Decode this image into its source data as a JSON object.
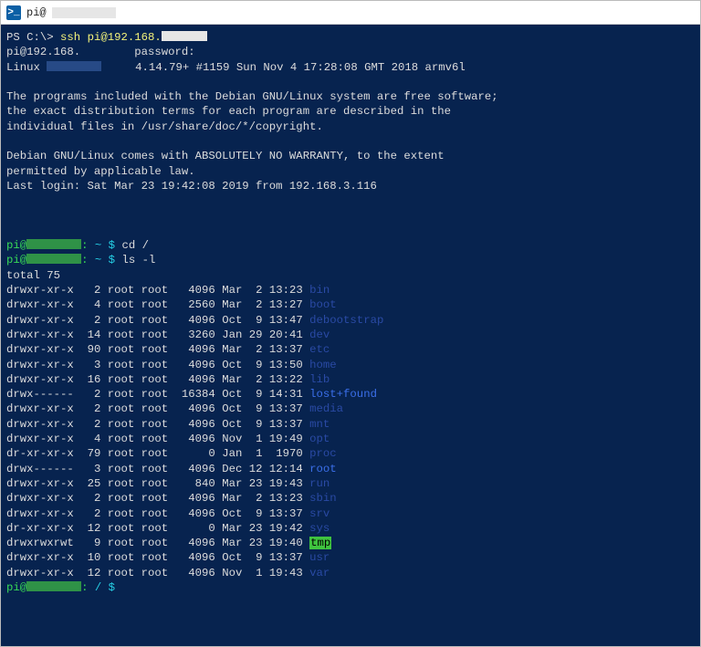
{
  "window": {
    "title": "pi@"
  },
  "prompt1": {
    "ps": "PS C:\\> ",
    "cmd": "ssh pi@192.168."
  },
  "login": {
    "line_pwd": "pi@192.168.        password:",
    "line_kernel_a": "Linux ",
    "line_kernel_b": "     4.14.79+ #1159 Sun Nov 4 17:28:08 GMT 2018 armv6l"
  },
  "motd": {
    "l1": "The programs included with the Debian GNU/Linux system are free software;",
    "l2": "the exact distribution terms for each program are described in the",
    "l3": "individual files in /usr/share/doc/*/copyright.",
    "l4": "Debian GNU/Linux comes with ABSOLUTELY NO WARRANTY, to the extent",
    "l5": "permitted by applicable law.",
    "l6": "Last login: Sat Mar 23 19:42:08 2019 from 192.168.3.116"
  },
  "p2": {
    "user": "pi@",
    "sep": ":",
    "tilde": "~ $",
    "cmd": "cd /"
  },
  "p3": {
    "user": "pi@",
    "sep": ":",
    "tilde": "~ $",
    "cmd": "ls -l"
  },
  "p4": {
    "user": "pi@",
    "sep": ":",
    "slash": "/ $"
  },
  "total": "total 75",
  "ls": [
    {
      "perm": "drwxr-xr-x",
      "n": "  2",
      "own": "root root",
      "size": "  4096",
      "date": "Mar  2 13:23",
      "name": "bin",
      "cls": "dkblue"
    },
    {
      "perm": "drwxr-xr-x",
      "n": "  4",
      "own": "root root",
      "size": "  2560",
      "date": "Mar  2 13:27",
      "name": "boot",
      "cls": "dkblue"
    },
    {
      "perm": "drwxr-xr-x",
      "n": "  2",
      "own": "root root",
      "size": "  4096",
      "date": "Oct  9 13:47",
      "name": "debootstrap",
      "cls": "dkblue"
    },
    {
      "perm": "drwxr-xr-x",
      "n": " 14",
      "own": "root root",
      "size": "  3260",
      "date": "Jan 29 20:41",
      "name": "dev",
      "cls": "dkblue"
    },
    {
      "perm": "drwxr-xr-x",
      "n": " 90",
      "own": "root root",
      "size": "  4096",
      "date": "Mar  2 13:37",
      "name": "etc",
      "cls": "dkblue"
    },
    {
      "perm": "drwxr-xr-x",
      "n": "  3",
      "own": "root root",
      "size": "  4096",
      "date": "Oct  9 13:50",
      "name": "home",
      "cls": "dkblue"
    },
    {
      "perm": "drwxr-xr-x",
      "n": " 16",
      "own": "root root",
      "size": "  4096",
      "date": "Mar  2 13:22",
      "name": "lib",
      "cls": "dkblue"
    },
    {
      "perm": "drwx------",
      "n": "  2",
      "own": "root root",
      "size": " 16384",
      "date": "Oct  9 14:31",
      "name": "lost+found",
      "cls": "blue"
    },
    {
      "perm": "drwxr-xr-x",
      "n": "  2",
      "own": "root root",
      "size": "  4096",
      "date": "Oct  9 13:37",
      "name": "media",
      "cls": "dkblue"
    },
    {
      "perm": "drwxr-xr-x",
      "n": "  2",
      "own": "root root",
      "size": "  4096",
      "date": "Oct  9 13:37",
      "name": "mnt",
      "cls": "dkblue"
    },
    {
      "perm": "drwxr-xr-x",
      "n": "  4",
      "own": "root root",
      "size": "  4096",
      "date": "Nov  1 19:49",
      "name": "opt",
      "cls": "dkblue"
    },
    {
      "perm": "dr-xr-xr-x",
      "n": " 79",
      "own": "root root",
      "size": "     0",
      "date": "Jan  1  1970",
      "name": "proc",
      "cls": "dkblue"
    },
    {
      "perm": "drwx------",
      "n": "  3",
      "own": "root root",
      "size": "  4096",
      "date": "Dec 12 12:14",
      "name": "root",
      "cls": "blue"
    },
    {
      "perm": "drwxr-xr-x",
      "n": " 25",
      "own": "root root",
      "size": "   840",
      "date": "Mar 23 19:43",
      "name": "run",
      "cls": "dkblue"
    },
    {
      "perm": "drwxr-xr-x",
      "n": "  2",
      "own": "root root",
      "size": "  4096",
      "date": "Mar  2 13:23",
      "name": "sbin",
      "cls": "dkblue"
    },
    {
      "perm": "drwxr-xr-x",
      "n": "  2",
      "own": "root root",
      "size": "  4096",
      "date": "Oct  9 13:37",
      "name": "srv",
      "cls": "dkblue"
    },
    {
      "perm": "dr-xr-xr-x",
      "n": " 12",
      "own": "root root",
      "size": "     0",
      "date": "Mar 23 19:42",
      "name": "sys",
      "cls": "dkblue"
    },
    {
      "perm": "drwxrwxrwt",
      "n": "  9",
      "own": "root root",
      "size": "  4096",
      "date": "Mar 23 19:40",
      "name": "tmp",
      "cls": "hl"
    },
    {
      "perm": "drwxr-xr-x",
      "n": " 10",
      "own": "root root",
      "size": "  4096",
      "date": "Oct  9 13:37",
      "name": "usr",
      "cls": "dkblue"
    },
    {
      "perm": "drwxr-xr-x",
      "n": " 12",
      "own": "root root",
      "size": "  4096",
      "date": "Nov  1 19:43",
      "name": "var",
      "cls": "dkblue"
    }
  ]
}
